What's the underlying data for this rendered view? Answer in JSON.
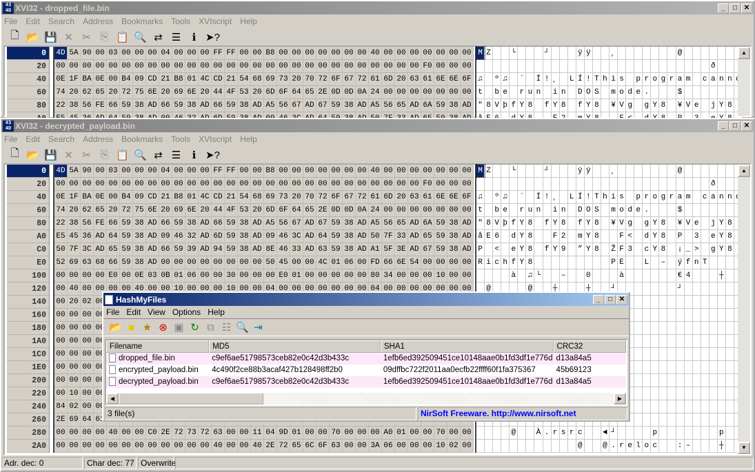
{
  "menu": [
    "File",
    "Edit",
    "Search",
    "Address",
    "Bookmarks",
    "Tools",
    "XVIscript",
    "Help"
  ],
  "toolbar_icons": [
    "new-file-icon",
    "open-icon",
    "save-icon",
    "delete-icon",
    "cut-icon",
    "copy-icon",
    "paste-icon",
    "find-icon",
    "replace-icon",
    "properties-icon",
    "info-icon",
    "help-pointer-icon"
  ],
  "top": {
    "title": "XVI32 - dropped_file.bin"
  },
  "bottom": {
    "title": "XVI32 - decrypted_payload.bin"
  },
  "hex_rows": [
    {
      "addr": "0",
      "bytes": "4D 5A 90 00 03 00 00 00 04 00 00 00 FF FF 00 00 B8 00 00 00 00 00 00 00 40 00 00 00 00 00 00 00"
    },
    {
      "addr": "20",
      "bytes": "00 00 00 00 00 00 00 00 00 00 00 00 00 00 00 00 00 00 00 00 00 00 00 00 00 00 00 00 F0 00 00 00"
    },
    {
      "addr": "40",
      "bytes": "0E 1F BA 0E 00 B4 09 CD 21 B8 01 4C CD 21 54 68 69 73 20 70 72 6F 67 72 61 6D 20 63 61 6E 6E 6F"
    },
    {
      "addr": "60",
      "bytes": "74 20 62 65 20 72 75 6E 20 69 6E 20 44 4F 53 20 6D 6F 64 65 2E 0D 0D 0A 24 00 00 00 00 00 00 00"
    },
    {
      "addr": "80",
      "bytes": "22 38 56 FE 66 59 38 AD 66 59 38 AD 66 59 38 AD A5 56 67 AD 67 59 38 AD A5 56 65 AD 6A 59 38 AD"
    },
    {
      "addr": "A0",
      "bytes": "E5 45 36 AD 64 59 38 AD 09 46 32 AD 6D 59 38 AD 09 46 3C AD 64 59 38 AD 50 7F 33 AD 65 59 38 AD"
    },
    {
      "addr": "C0",
      "bytes": "50 7F 3C AD 65 59 38 AD 66 59 39 AD 94 59 38 AD 8E 46 33 AD 63 59 38 AD A1 5F 3E AD 67 59 38 AD"
    },
    {
      "addr": "E0",
      "bytes": "52 69 63 68 66 59 38 AD 00 00 00 00 00 00 00 00 50 45 00 00 4C 01 06 00 FD 66 6E 54 00 00 00 00"
    },
    {
      "addr": "100",
      "bytes": "00 00 00 00 E0 00 0E 03 0B 01 06 00 00 30 00 00 00 E0 01 00 00 00 00 00 80 34 00 00 00 10 00 00"
    },
    {
      "addr": "120",
      "bytes": "00 40 00 00 00 00 40 00 00 10 00 00 00 10 00 00 04 00 00 00 00 00 00 00 04 00 00 00 00 00 00 00"
    },
    {
      "addr": "140",
      "bytes": "00 20 02 00"
    },
    {
      "addr": "160",
      "bytes": "00 00 00 00"
    },
    {
      "addr": "180",
      "bytes": "00 00 00 00"
    },
    {
      "addr": "1A0",
      "bytes": "00 00 00 00"
    },
    {
      "addr": "1C0",
      "bytes": "00 00 00 00"
    },
    {
      "addr": "1E0",
      "bytes": "00 00 00 00"
    },
    {
      "addr": "200",
      "bytes": "00 00 00 00"
    },
    {
      "addr": "220",
      "bytes": "00 10 00 00"
    },
    {
      "addr": "240",
      "bytes": "84 02 00 00"
    },
    {
      "addr": "260",
      "bytes": "2E 69 64 61"
    },
    {
      "addr": "280",
      "bytes": "00 00 00 00 40 00 00 C0 2E 72 73 72 63 00 00 11 04 9D 01 00 00 70 00 00 00 A0 01 00 00 70 00 00"
    },
    {
      "addr": "2A0",
      "bytes": "00 00 00 00 00 00 00 00 00 00 00 00 40 00 00 40 2E 72 65 6C 6F 63 00 00 3A 06 00 00 00 10 02 00"
    }
  ],
  "status": {
    "adr": "Adr. dec: 0",
    "char": "Char dec: 77",
    "mode": "Overwrite"
  },
  "hmf": {
    "title": "HashMyFiles",
    "menu": [
      "File",
      "Edit",
      "View",
      "Options",
      "Help"
    ],
    "columns": [
      "Filename",
      "MD5",
      "SHA1",
      "CRC32"
    ],
    "rows": [
      {
        "name": "dropped_file.bin",
        "md5": "c9ef6ae51798573ceb82e0c42d3b433c",
        "sha1": "1efb6ed392509451ce10148aae0b1fd3df1e776d",
        "crc": "d13a84a5"
      },
      {
        "name": "encrypted_payload.bin",
        "md5": "4c490f2ce88b3acaf427b128498ff2b0",
        "sha1": "09dffbc722f2011aa0ecfb22ffff60f1fa375367",
        "crc": "45b69123"
      },
      {
        "name": "decrypted_payload.bin",
        "md5": "c9ef6ae51798573ceb82e0c42d3b433c",
        "sha1": "1efb6ed392509451ce10148aae0b1fd3df1e776d",
        "crc": "d13a84a5"
      }
    ],
    "status_count": "3 file(s)",
    "status_link": "NirSoft Freeware.  http://www.nirsoft.net",
    "link_color": "#0000ff"
  }
}
